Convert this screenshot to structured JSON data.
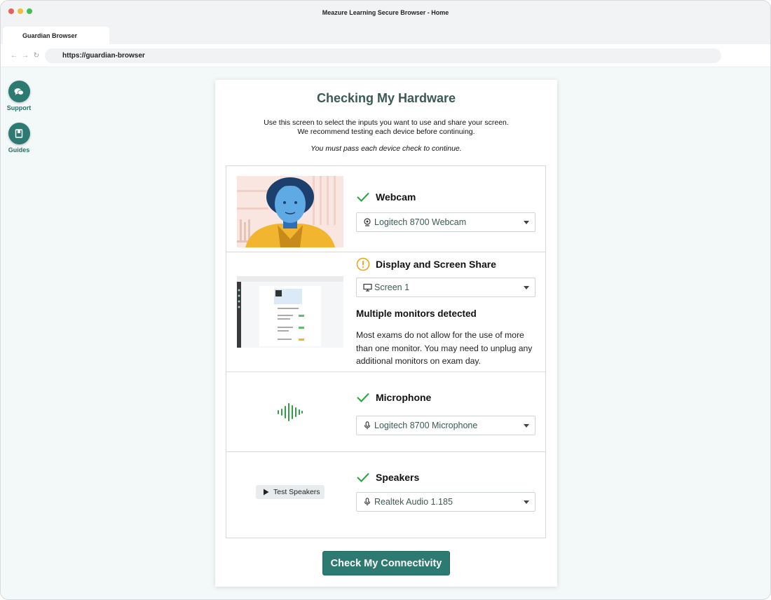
{
  "window": {
    "title": "Meazure Learning Secure Browser - Home"
  },
  "tab": {
    "label": "Guardian Browser"
  },
  "address_bar": {
    "url": "https://guardian-browser"
  },
  "sidebar": {
    "items": [
      {
        "label": "Support",
        "icon": "chat-bubbles-icon"
      },
      {
        "label": "Guides",
        "icon": "book-icon"
      }
    ]
  },
  "page": {
    "title": "Checking My Hardware",
    "intro_line1": "Use this screen to select the inputs you want to use and share your screen.",
    "intro_line2": "We recommend testing each device before continuing.",
    "notice": "You must pass each device check to continue."
  },
  "devices": {
    "webcam": {
      "name": "Webcam",
      "status": "passed",
      "selected": "Logitech 8700 Webcam",
      "select_icon": "webcam-icon"
    },
    "display": {
      "name": "Display and Screen Share",
      "status": "warning",
      "selected": "Screen 1",
      "select_icon": "monitor-icon",
      "warning_title": "Multiple monitors detected",
      "warning_body": "Most exams do not allow for the use of more than one monitor. You may need to unplug any additional monitors on exam day."
    },
    "microphone": {
      "name": "Microphone",
      "status": "passed",
      "selected": "Logitech 8700 Microphone",
      "select_icon": "microphone-icon"
    },
    "speakers": {
      "name": "Speakers",
      "status": "passed",
      "selected": "Realtek Audio 1.185",
      "select_icon": "microphone-icon",
      "test_button": "Test Speakers"
    }
  },
  "actions": {
    "continue_button": "Check My Connectivity"
  },
  "colors": {
    "accent": "#2d7a72",
    "pass": "#2ea043",
    "warning": "#e6a817",
    "title": "#3b5a55"
  }
}
